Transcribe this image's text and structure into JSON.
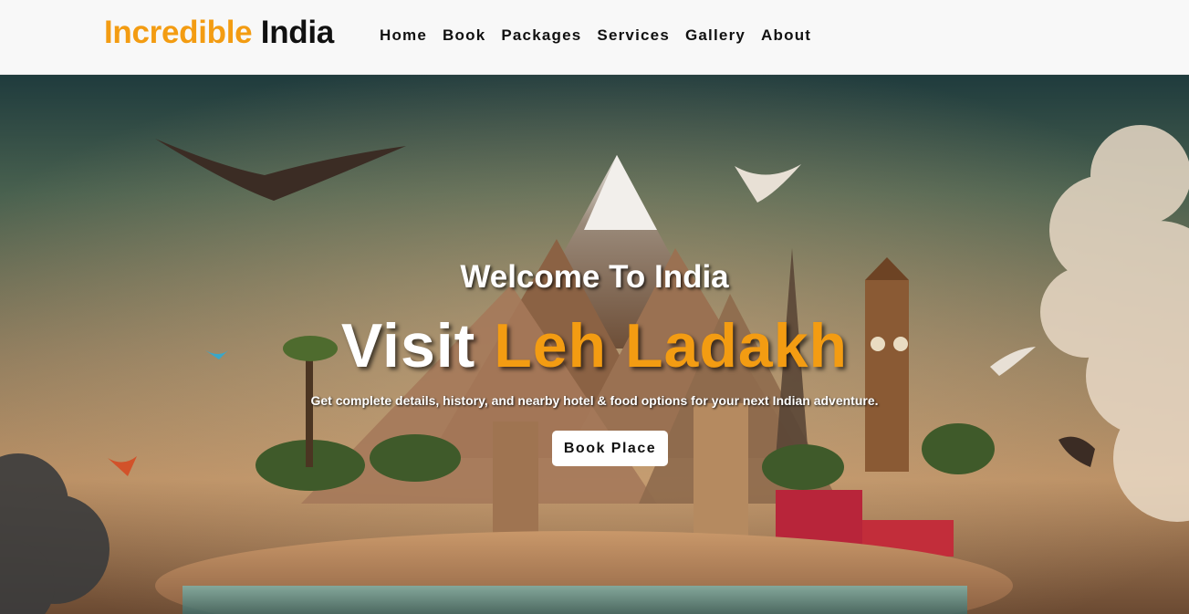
{
  "brand": {
    "accent": "Incredible",
    "rest": "India",
    "accent_color": "#f39c12"
  },
  "nav": {
    "items": [
      "Home",
      "Book",
      "Packages",
      "Services",
      "Gallery",
      "About"
    ]
  },
  "hero": {
    "welcome": "Welcome To India",
    "visit_prefix": "Visit",
    "destination": "Leh Ladakh",
    "description": "Get complete details, history, and nearby hotel & food options for your next Indian adventure.",
    "cta_label": "Book Place",
    "background_image": "fantasy travel collage with mountain, landmarks, birds and clouds"
  }
}
